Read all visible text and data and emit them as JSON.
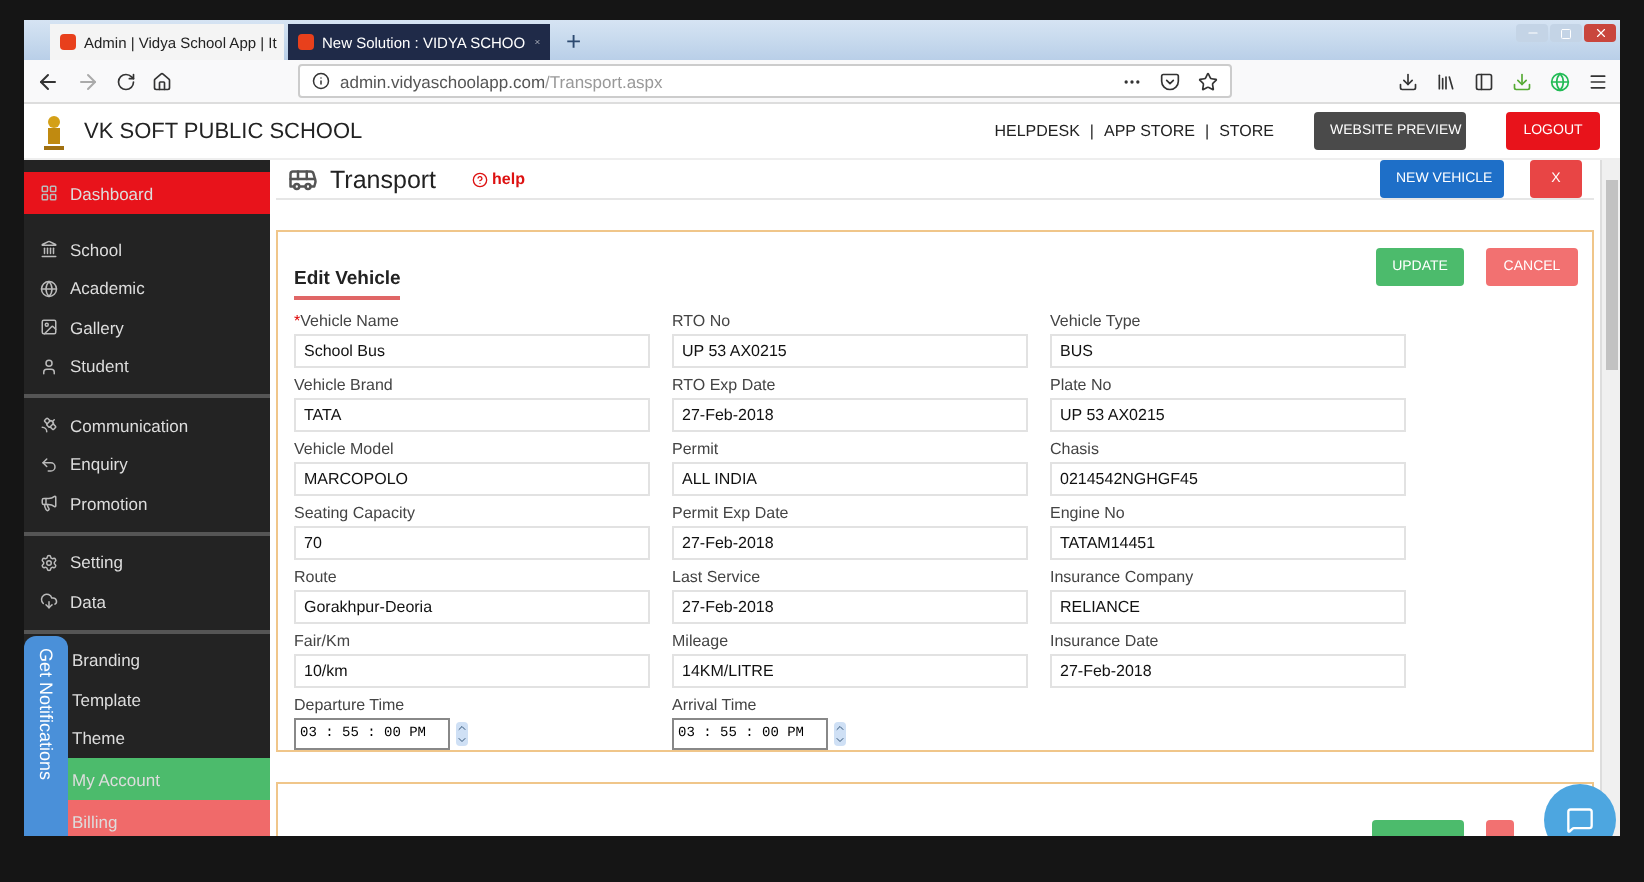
{
  "browser": {
    "tabs": [
      {
        "label": "Admin | Vidya School App | It",
        "selected": true
      },
      {
        "label": "New Solution : VIDYA SCHOO",
        "selected": false
      }
    ],
    "url_host": "admin.vidyaschoolapp.com",
    "url_path": "/Transport.aspx",
    "new_tab": "+"
  },
  "header": {
    "school": "VK SOFT PUBLIC SCHOOL",
    "links": [
      "HELPDESK",
      "APP STORE",
      "STORE"
    ],
    "separator": "|",
    "preview_button": "WEBSITE PREVIEW",
    "logout_button": "LOGOUT"
  },
  "sidebar": {
    "groups": [
      [
        {
          "label": "Dashboard",
          "color": "#e8131b"
        }
      ],
      [
        {
          "label": "School"
        },
        {
          "label": "Academic"
        },
        {
          "label": "Gallery"
        },
        {
          "label": "Student"
        }
      ],
      [
        {
          "label": "Communication"
        },
        {
          "label": "Enquiry"
        },
        {
          "label": "Promotion"
        }
      ],
      [
        {
          "label": "Setting"
        },
        {
          "label": "Data"
        }
      ],
      [
        {
          "label": "Branding"
        },
        {
          "label": "Template"
        },
        {
          "label": "Theme"
        },
        {
          "label": "My Account",
          "color": "#4cbb6c"
        },
        {
          "label": "Billing",
          "color": "#f06a6a"
        }
      ]
    ]
  },
  "page": {
    "title": "Transport",
    "help": "help",
    "new_button": "NEW VEHICLE",
    "close_button": "X"
  },
  "form": {
    "title": "Edit Vehicle",
    "update_button": "UPDATE",
    "cancel_button": "CANCEL",
    "fields": [
      {
        "label": "Vehicle Name",
        "value": "School Bus",
        "kind": "text",
        "marker": "*"
      },
      {
        "label": "RTO No",
        "value": "UP 53 AX0215",
        "kind": "text"
      },
      {
        "label": "Vehicle Type",
        "value": "BUS",
        "kind": "text"
      },
      {
        "label": "Vehicle Brand",
        "value": "TATA",
        "kind": "text"
      },
      {
        "label": "RTO Exp Date",
        "value": "27-Feb-2018",
        "kind": "text"
      },
      {
        "label": "Plate No",
        "value": "UP 53 AX0215",
        "kind": "text"
      },
      {
        "label": "Vehicle Model",
        "value": "MARCOPOLO",
        "kind": "text"
      },
      {
        "label": "Permit",
        "value": "ALL INDIA",
        "kind": "text"
      },
      {
        "label": "Chasis",
        "value": "0214542NGHGF45",
        "kind": "text"
      },
      {
        "label": "Seating Capacity",
        "value": "70",
        "kind": "text"
      },
      {
        "label": "Permit Exp Date",
        "value": "27-Feb-2018",
        "kind": "text"
      },
      {
        "label": "Engine No",
        "value": "TATAM14451",
        "kind": "text"
      },
      {
        "label": "Route",
        "value": "Gorakhpur-Deoria",
        "kind": "text"
      },
      {
        "label": "Last Service",
        "value": "27-Feb-2018",
        "kind": "text"
      },
      {
        "label": "Insurance Company",
        "value": "RELIANCE",
        "kind": "text"
      },
      {
        "label": "Fair/Km",
        "value": "10/km",
        "kind": "text"
      },
      {
        "label": "Mileage",
        "value": "14KM/LITRE",
        "kind": "text"
      },
      {
        "label": "Insurance Date",
        "value": "27-Feb-2018",
        "kind": "text"
      },
      {
        "label": "Departure Time",
        "value": "03 : 55 : 00 PM",
        "kind": "time"
      },
      {
        "label": "Arrival Time",
        "value": "03 : 55 : 00 PM",
        "kind": "time"
      }
    ]
  },
  "notifications_tab": "Get Notifications"
}
